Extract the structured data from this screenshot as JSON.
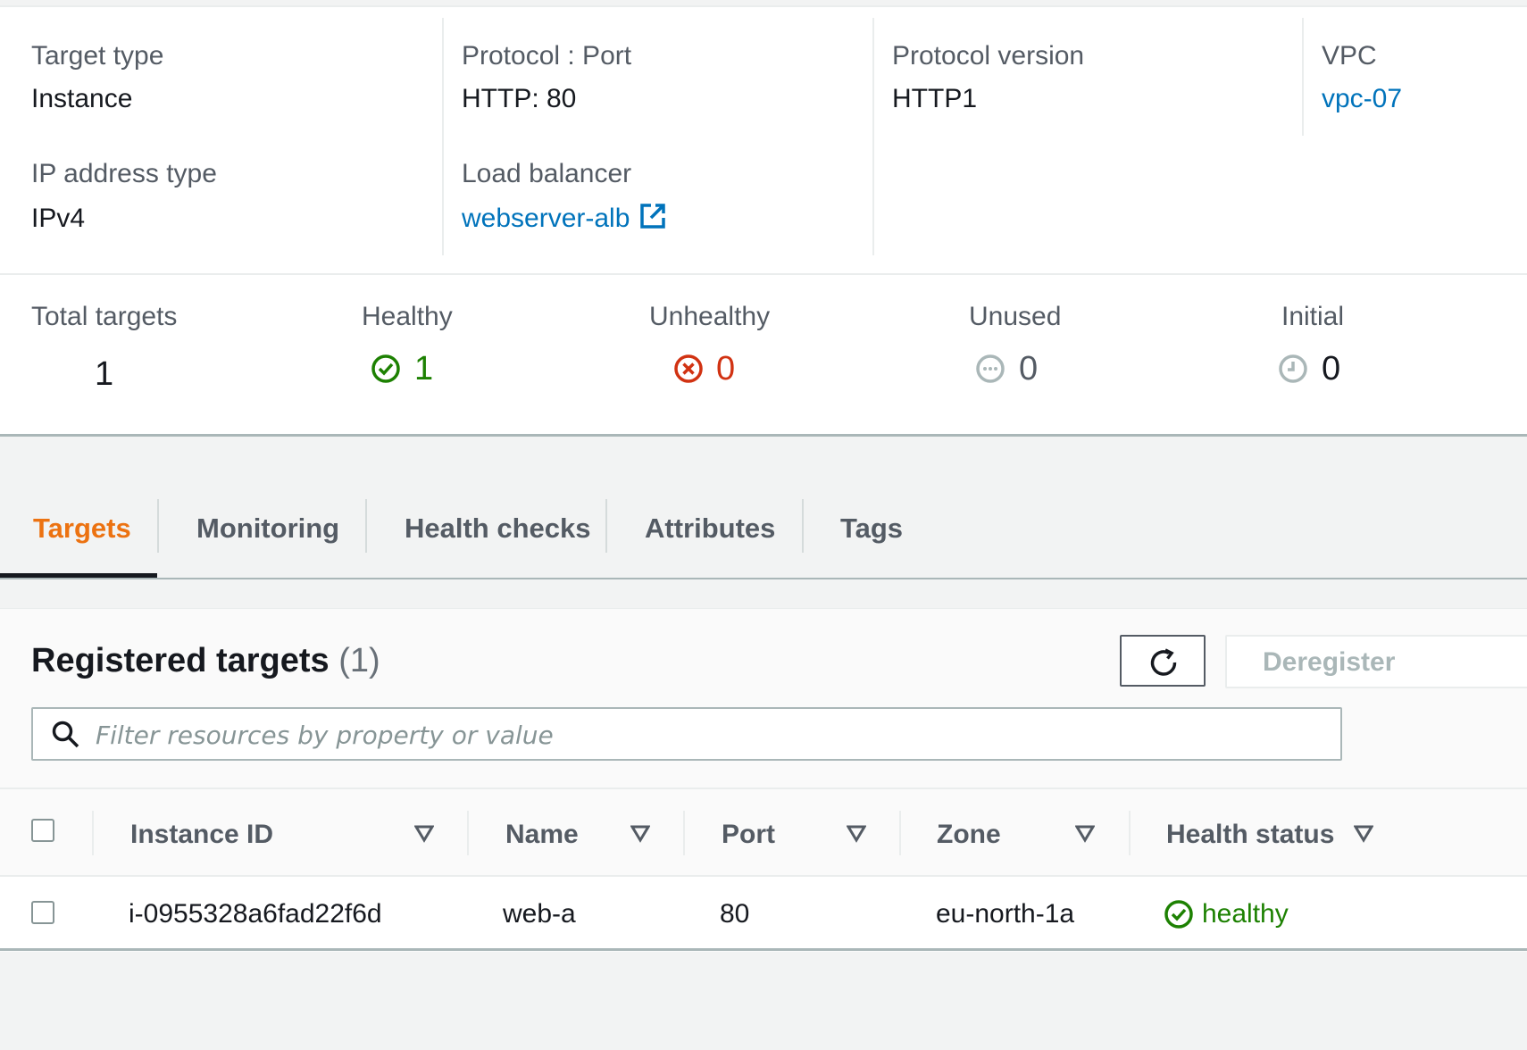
{
  "details": {
    "target_type": {
      "label": "Target type",
      "value": "Instance"
    },
    "protocol_port": {
      "label": "Protocol : Port",
      "value": "HTTP: 80"
    },
    "protocol_version": {
      "label": "Protocol version",
      "value": "HTTP1"
    },
    "vpc": {
      "label": "VPC",
      "value": "vpc-07"
    },
    "ip_address_type": {
      "label": "IP address type",
      "value": "IPv4"
    },
    "load_balancer": {
      "label": "Load balancer",
      "value": "webserver-alb",
      "icon": "external-link-icon"
    }
  },
  "counts": {
    "total": {
      "label": "Total targets",
      "value": "1"
    },
    "healthy": {
      "label": "Healthy",
      "value": "1",
      "icon": "check-circle-icon",
      "color": "#1d8102"
    },
    "unhealthy": {
      "label": "Unhealthy",
      "value": "0",
      "icon": "x-circle-icon",
      "color": "#d13212"
    },
    "unused": {
      "label": "Unused",
      "value": "0",
      "icon": "ellipsis-circle-icon",
      "color": "#aab7b8"
    },
    "initial": {
      "label": "Initial",
      "value": "0",
      "icon": "clock-icon",
      "color": "#aab7b8"
    }
  },
  "tabs": [
    {
      "label": "Targets",
      "active": true
    },
    {
      "label": "Monitoring",
      "active": false
    },
    {
      "label": "Health checks",
      "active": false
    },
    {
      "label": "Attributes",
      "active": false
    },
    {
      "label": "Tags",
      "active": false
    }
  ],
  "registered": {
    "title": "Registered targets",
    "count": "(1)",
    "refresh_icon": "refresh-icon",
    "deregister_label": "Deregister",
    "search_placeholder": "Filter resources by property or value",
    "search_value": ""
  },
  "table": {
    "columns": [
      "Instance ID",
      "Name",
      "Port",
      "Zone",
      "Health status"
    ],
    "rows": [
      {
        "instance_id": "i-0955328a6fad22f6d",
        "name": "web-a",
        "port": "80",
        "zone": "eu-north-1a",
        "health_status": "healthy"
      }
    ]
  },
  "colors": {
    "accent": "#ec7211",
    "link": "#0073bb",
    "healthy": "#1d8102",
    "unhealthy": "#d13212"
  }
}
